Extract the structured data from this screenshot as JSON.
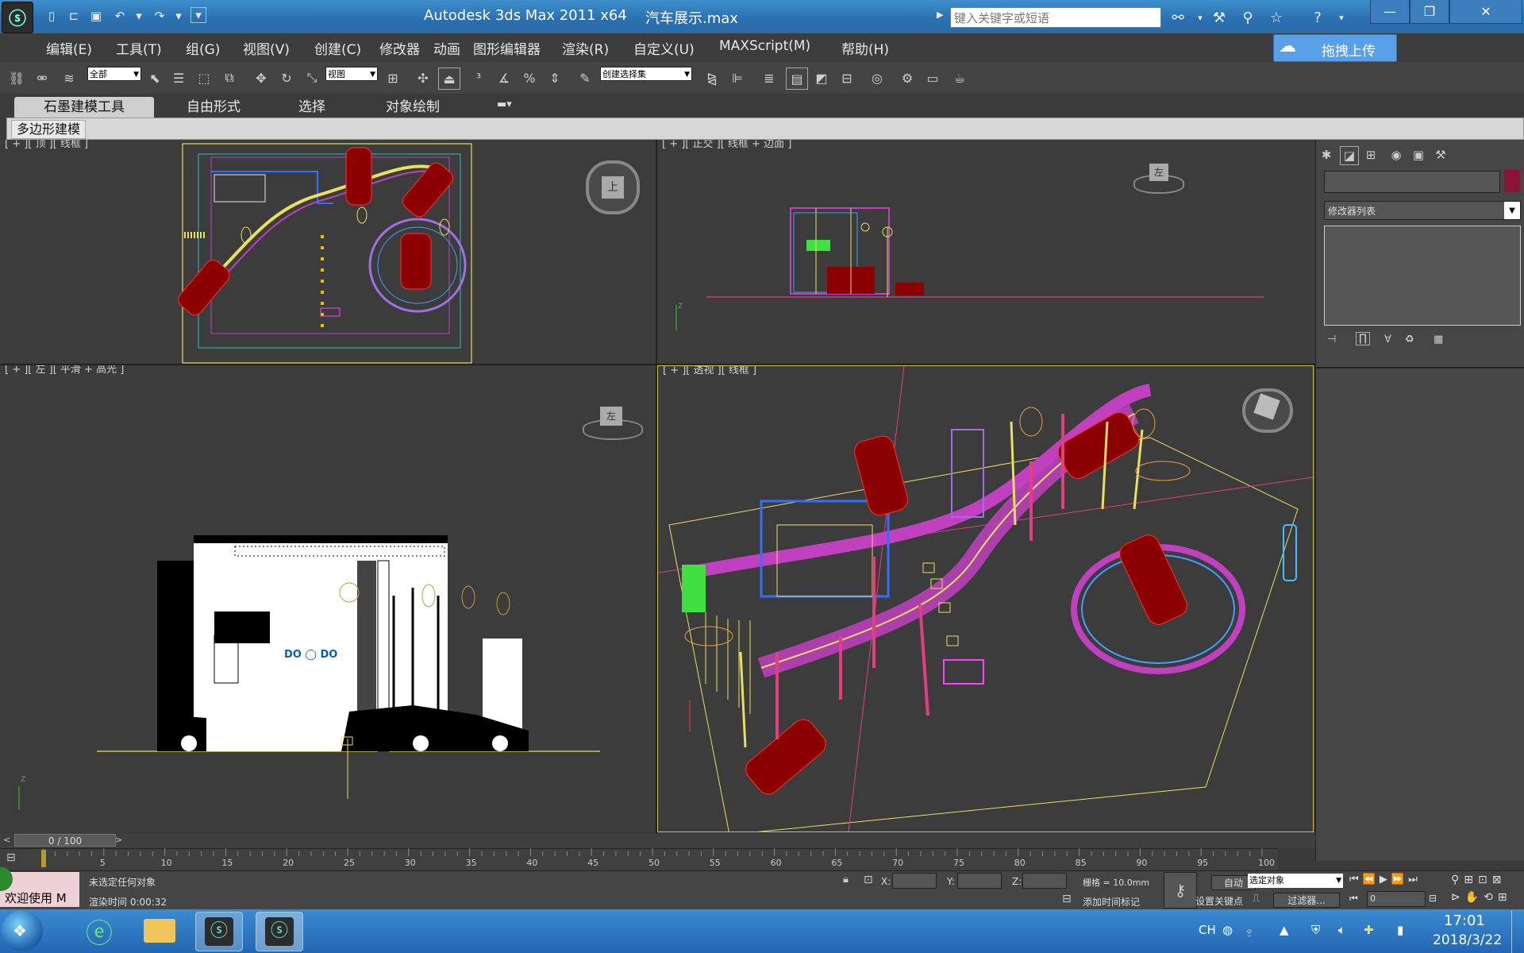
{
  "window": {
    "title": "Autodesk 3ds Max  2011 x64",
    "file": "汽车展示.max",
    "search_placeholder": "键入关键字或短语",
    "controls": {
      "minimize": "—",
      "restore": "❐",
      "close": "✕"
    }
  },
  "menu": {
    "items": [
      "编辑(E)",
      "工具(T)",
      "组(G)",
      "视图(V)",
      "创建(C)",
      "修改器",
      "动画",
      "图形编辑器",
      "渲染(R)",
      "自定义(U)",
      "MAXScript(M)",
      "帮助(H)"
    ],
    "upload_button": "拖拽上传"
  },
  "toolbar": {
    "selection_filter": "全部",
    "reference_coord": "视图",
    "named_selection": "创建选择集"
  },
  "ribbon": {
    "tabs": [
      "石墨建模工具",
      "自由形式",
      "选择",
      "对象绘制"
    ],
    "panel_label": "多边形建模"
  },
  "viewports": {
    "top_label": "[ + ][ 顶 ][ 线框 ]",
    "front_label": "[ + ][ 正交 ][ 线框 + 边面 ]",
    "left_label": "[ + ][ 左 ][ 平滑 + 高光 ]",
    "persp_label": "[ + ][ 透视 ][ 线框 ]",
    "cube_top": "上",
    "cube_front": "左",
    "cube_left": "左"
  },
  "command_panel": {
    "modifier_list": "修改器列表"
  },
  "timeline": {
    "frame_counter": "0 / 100",
    "ticks": [
      "5",
      "10",
      "15",
      "20",
      "25",
      "30",
      "35",
      "40",
      "45",
      "50",
      "55",
      "60",
      "65",
      "70",
      "75",
      "80",
      "85",
      "90",
      "95",
      "100"
    ]
  },
  "status": {
    "welcome": "欢迎使用 M",
    "selection_status": "未选定任何对象",
    "render_time": "渲染时间  0:00:32",
    "x_label": "X:",
    "y_label": "Y:",
    "z_label": "Z:",
    "grid": "栅格 = 10.0mm",
    "add_time_tag": "添加时间标记",
    "auto_key": "自动",
    "set_key": "设置关键点",
    "selected_object": "选定对象",
    "filters": "过滤器...",
    "frame_value": "0"
  },
  "taskbar": {
    "lang": "CH",
    "time": "17:01",
    "date": "2018/3/22"
  },
  "colors": {
    "car": "#8b0000",
    "wire_yellow": "#e8e060",
    "wire_magenta": "#c040c0",
    "wire_green": "#40e040"
  }
}
